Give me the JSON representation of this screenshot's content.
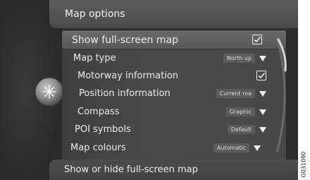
{
  "header": {
    "title": "Map options"
  },
  "menu": {
    "items": [
      {
        "label": "Show full-screen map",
        "control": "checkbox",
        "checked": true,
        "selected": true
      },
      {
        "label": "Map type",
        "control": "dropdown",
        "value": "North up"
      },
      {
        "label": "Motorway information",
        "control": "checkbox",
        "checked": true
      },
      {
        "label": "Position information",
        "control": "dropdown",
        "value": "Current roa"
      },
      {
        "label": "Compass",
        "control": "dropdown",
        "value": "Graphic"
      },
      {
        "label": "POI symbols",
        "control": "dropdown",
        "value": "Default"
      },
      {
        "label": "Map colours",
        "control": "dropdown",
        "value": "Automatic"
      }
    ]
  },
  "status": {
    "help_text": "Show or hide full-screen map"
  },
  "image_code": "G031090",
  "colors": {
    "background": "#2c2c2c",
    "panel": "#4a4a4a",
    "selected_row": "#626262",
    "text": "#ececec"
  },
  "icons": {
    "nav_knob": "compass-knob-icon",
    "dropdown": "triangle-down-icon",
    "check": "checkmark-icon"
  }
}
